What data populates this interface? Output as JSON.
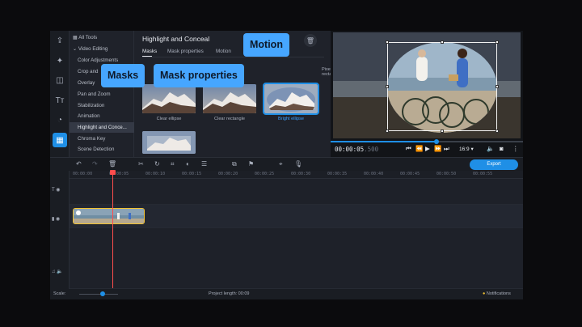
{
  "app": {
    "tools": {
      "header": "All Tools",
      "group": "Video Editing",
      "items": [
        "Color Adjustments",
        "Crop and",
        "Overlay",
        "Pan and Zoom",
        "Stabilization",
        "Animation",
        "Highlight and Conce...",
        "Chroma Key",
        "Scene Detection"
      ],
      "active_index": 6
    },
    "panel": {
      "title": "Highlight and Conceal",
      "tabs": [
        "Masks",
        "Mask properties",
        "Motion"
      ],
      "active_tab": 0,
      "presets": [
        {
          "label": "Clear ellipse",
          "selected": false
        },
        {
          "label": "Clear rectangle",
          "selected": false
        },
        {
          "label": "Bright ellipse",
          "selected": true
        }
      ],
      "extra_label": "Pixel rectangle"
    },
    "callouts": {
      "motion": "Motion",
      "masks": "Masks",
      "mask_properties": "Mask properties"
    },
    "preview": {
      "time": "00:00:05",
      "time_fraction": ".500",
      "aspect": "16:9",
      "progress": 0.55
    },
    "toolbar": {
      "export": "Export"
    },
    "timeline": {
      "ticks": [
        "00:00:00",
        "00:00:05",
        "00:00:10",
        "00:00:15",
        "00:00:20",
        "00:00:25",
        "00:00:30",
        "00:00:35",
        "00:00:40",
        "00:00:45",
        "00:00:50",
        "00:00:55"
      ]
    },
    "status": {
      "scale": "Scale:",
      "project_length": "Project length:  00:09",
      "notifications": "Notifications"
    }
  },
  "colors": {
    "accent": "#1f8fe6",
    "callout": "#46a6ff",
    "clip_border": "#f1c232",
    "playhead": "#ff4d4d"
  }
}
